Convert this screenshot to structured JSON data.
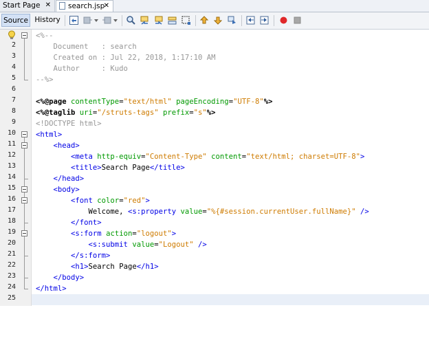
{
  "tabs": [
    {
      "label": "Start Page",
      "active": false
    },
    {
      "label": "search.jsp",
      "active": true
    }
  ],
  "editor_modes": {
    "source": "Source",
    "history": "History"
  },
  "toolbar_icons": [
    "last-edit-icon",
    "back-icon",
    "forward-icon",
    "find-icon",
    "find-previous-icon",
    "find-next-icon",
    "toggle-highlight-icon",
    "toggle-rect-selection-icon",
    "previous-bookmark-icon",
    "next-bookmark-icon",
    "toggle-bookmark-icon",
    "shift-left-icon",
    "shift-right-icon",
    "start-macro-icon",
    "stop-macro-icon"
  ],
  "line_numbers": [
    "1",
    "2",
    "3",
    "4",
    "5",
    "6",
    "7",
    "8",
    "9",
    "10",
    "11",
    "12",
    "13",
    "14",
    "15",
    "16",
    "17",
    "18",
    "19",
    "20",
    "21",
    "22",
    "23",
    "24",
    "25"
  ],
  "code": {
    "l1": "<%--",
    "l2": "    Document   : search",
    "l3": "    Created on : Jul 22, 2018, 1:17:10 AM",
    "l4": "    Author     : Kudo",
    "l5": "--%>",
    "l7a": "<%@page ",
    "l7b": "contentType",
    "l7c": "=",
    "l7d": "\"text/html\"",
    "l7e": " pageEncoding",
    "l7f": "=",
    "l7g": "\"UTF-8\"",
    "l7h": "%>",
    "l8a": "<%@taglib ",
    "l8b": "uri",
    "l8c": "=",
    "l8d": "\"/struts-tags\"",
    "l8e": " prefix",
    "l8f": "=",
    "l8g": "\"s\"",
    "l8h": "%>",
    "l9": "<!DOCTYPE html>",
    "l10": "<html>",
    "l11": "    <head>",
    "l12a": "        <meta ",
    "l12b": "http-equiv",
    "l12c": "=",
    "l12d": "\"Content-Type\"",
    "l12e": " content",
    "l12f": "=",
    "l12g": "\"text/html; charset=UTF-8\"",
    "l12h": ">",
    "l13a": "        <title>",
    "l13b": "Search Page",
    "l13c": "</title>",
    "l14": "    </head>",
    "l15": "    <body>",
    "l16a": "        <font ",
    "l16b": "color",
    "l16c": "=",
    "l16d": "\"red\"",
    "l16e": ">",
    "l17a": "            Welcome, ",
    "l17b": "<s:property ",
    "l17c": "value",
    "l17d": "=",
    "l17e": "\"%{#session.currentUser.fullName}\"",
    "l17f": " />",
    "l18": "        </font>",
    "l19a": "        <s:form ",
    "l19b": "action",
    "l19c": "=",
    "l19d": "\"logout\"",
    "l19e": ">",
    "l20a": "            <s:submit ",
    "l20b": "value",
    "l20c": "=",
    "l20d": "\"Logout\"",
    "l20e": " />",
    "l21": "        </s:form>",
    "l22a": "        <h1>",
    "l22b": "Search Page",
    "l22c": "</h1>",
    "l23": "    </body>",
    "l24": "</html>"
  },
  "colors": {
    "tag": "#0000e6",
    "attr": "#009900",
    "value": "#ce7b00",
    "comment": "#969696"
  }
}
